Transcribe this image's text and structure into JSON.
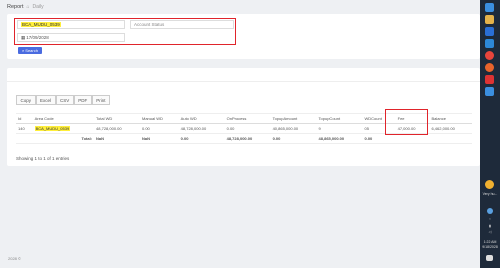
{
  "topbar": {
    "title": "Report",
    "crumb": "Daily"
  },
  "filters": {
    "area_code": "BCA_MUDU_0539",
    "account_status_placeholder": "Account Status",
    "date": "17/09/2028",
    "search_label": "Search"
  },
  "export": {
    "buttons": [
      "Copy",
      "Excel",
      "CSV",
      "PDF",
      "Print"
    ]
  },
  "table": {
    "columns": [
      "Id",
      "Area Code",
      "Total WD",
      "Manual WD",
      "Auto WD",
      "OnProcess",
      "TopupAmount",
      "TopupCount",
      "WDCount",
      "Fee",
      "Balance"
    ],
    "rows": [
      [
        "140",
        "BCA_MUDU_0539",
        "48,728,000.00",
        "0.00",
        "48,728,000.00",
        "0.00",
        "40,865,000.00",
        "9",
        "05",
        "47,000.00",
        "6,462,000.00"
      ]
    ],
    "totals": [
      "",
      "Total:",
      "NaN",
      "NaN",
      "",
      "0.00",
      "48,728,000.00",
      "0.00",
      "",
      "48,865,000.00",
      "",
      "0.00"
    ]
  },
  "showing": "Showing 1 to 1 of 1 entries",
  "footer": "2028 ©",
  "taskbar": {
    "weather": "Very hu...",
    "time": "1:22 AM",
    "date": "9/18/2028"
  },
  "colors": {
    "highlight": "#ffef3b",
    "red_box": "#e0242b",
    "search_btn": "#4a6be0"
  }
}
